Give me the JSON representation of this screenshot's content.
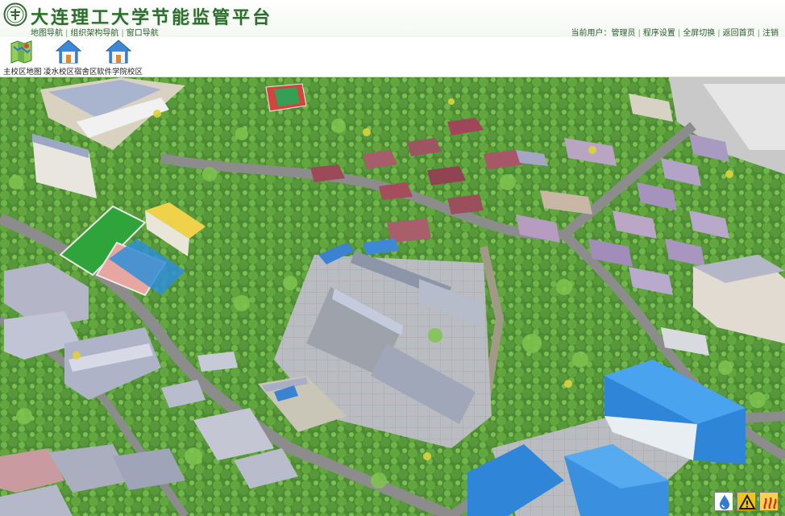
{
  "header": {
    "title": "大连理工大学节能监管平台",
    "left_nav": [
      "地图导航",
      "组织架构导航",
      "窗口导航"
    ],
    "current_user_label": "当前用户：",
    "current_user": "管理员",
    "right_nav": [
      "程序设置",
      "全屏切换",
      "返回首页",
      "注销"
    ],
    "separator": "|"
  },
  "toolbar": {
    "items": [
      {
        "label": "主校区地图",
        "icon": "campus-map-icon"
      },
      {
        "label": "凌水校区宿舍区",
        "icon": "home-icon"
      },
      {
        "label": "软件学院校区",
        "icon": "home-icon"
      }
    ]
  },
  "map": {
    "status_icons": [
      {
        "name": "water-icon",
        "color": "#2f7bd8"
      },
      {
        "name": "warning-icon",
        "color": "#f0c419"
      },
      {
        "name": "heating-icon",
        "color": "#e02020"
      }
    ]
  },
  "colors": {
    "brand_green": "#2c6e2e",
    "grass": "#5f8f45",
    "road": "#8c8c8c",
    "roof_blue": "#3d8ee0",
    "roof_gray": "#a9b2c8"
  }
}
